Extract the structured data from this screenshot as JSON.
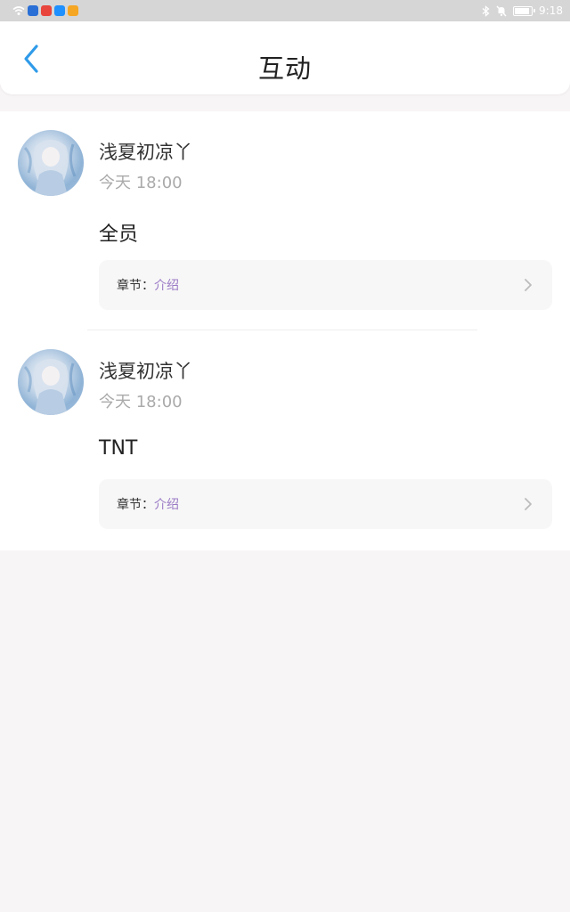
{
  "status_bar": {
    "time": "9:18",
    "app_icons": [
      {
        "name": "wifi-icon"
      },
      {
        "name": "shield-app-icon",
        "color": "#2a6fd6"
      },
      {
        "name": "red-app-icon",
        "color": "#e8453c"
      },
      {
        "name": "search-app-icon",
        "color": "#1e90ff"
      },
      {
        "name": "orange-app-icon",
        "color": "#f5a623"
      }
    ],
    "battery_level": 0.9
  },
  "header": {
    "title": "互动",
    "back_icon": "chevron-left-icon",
    "accent_color": "#2f9be9"
  },
  "posts": [
    {
      "username": "浅夏初凉丫",
      "time": "今天 18:00",
      "text": "全员",
      "chapter_label": "章节：",
      "chapter_value": "介绍"
    },
    {
      "username": "浅夏初凉丫",
      "time": "今天 18:00",
      "text": "TNT",
      "chapter_label": "章节：",
      "chapter_value": "介绍"
    }
  ]
}
